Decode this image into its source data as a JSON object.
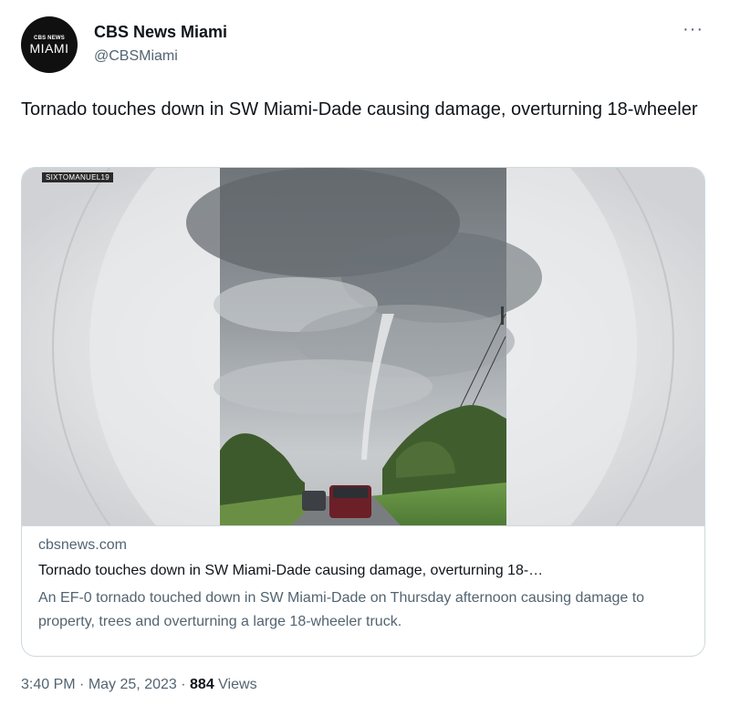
{
  "author": {
    "name": "CBS News Miami",
    "handle": "@CBSMiami",
    "avatar_line1": "CBS NEWS",
    "avatar_line2": "MIAMI"
  },
  "more_icon": "more-horizontal-icon",
  "tweet_text": "Tornado touches down in SW Miami-Dade causing damage, overturning 18-wheeler",
  "card": {
    "watermark": "SIXTOMANUEL19",
    "domain": "cbsnews.com",
    "title": "Tornado touches down in SW Miami-Dade causing damage, overturning 18-…",
    "description": "An EF-0 tornado touched down in SW Miami-Dade on Thursday afternoon causing damage to property, trees and overturning a large 18-wheeler truck."
  },
  "meta": {
    "time": "3:40 PM",
    "separator": "·",
    "date": "May 25, 2023",
    "views_count": "884",
    "views_label": "Views"
  }
}
